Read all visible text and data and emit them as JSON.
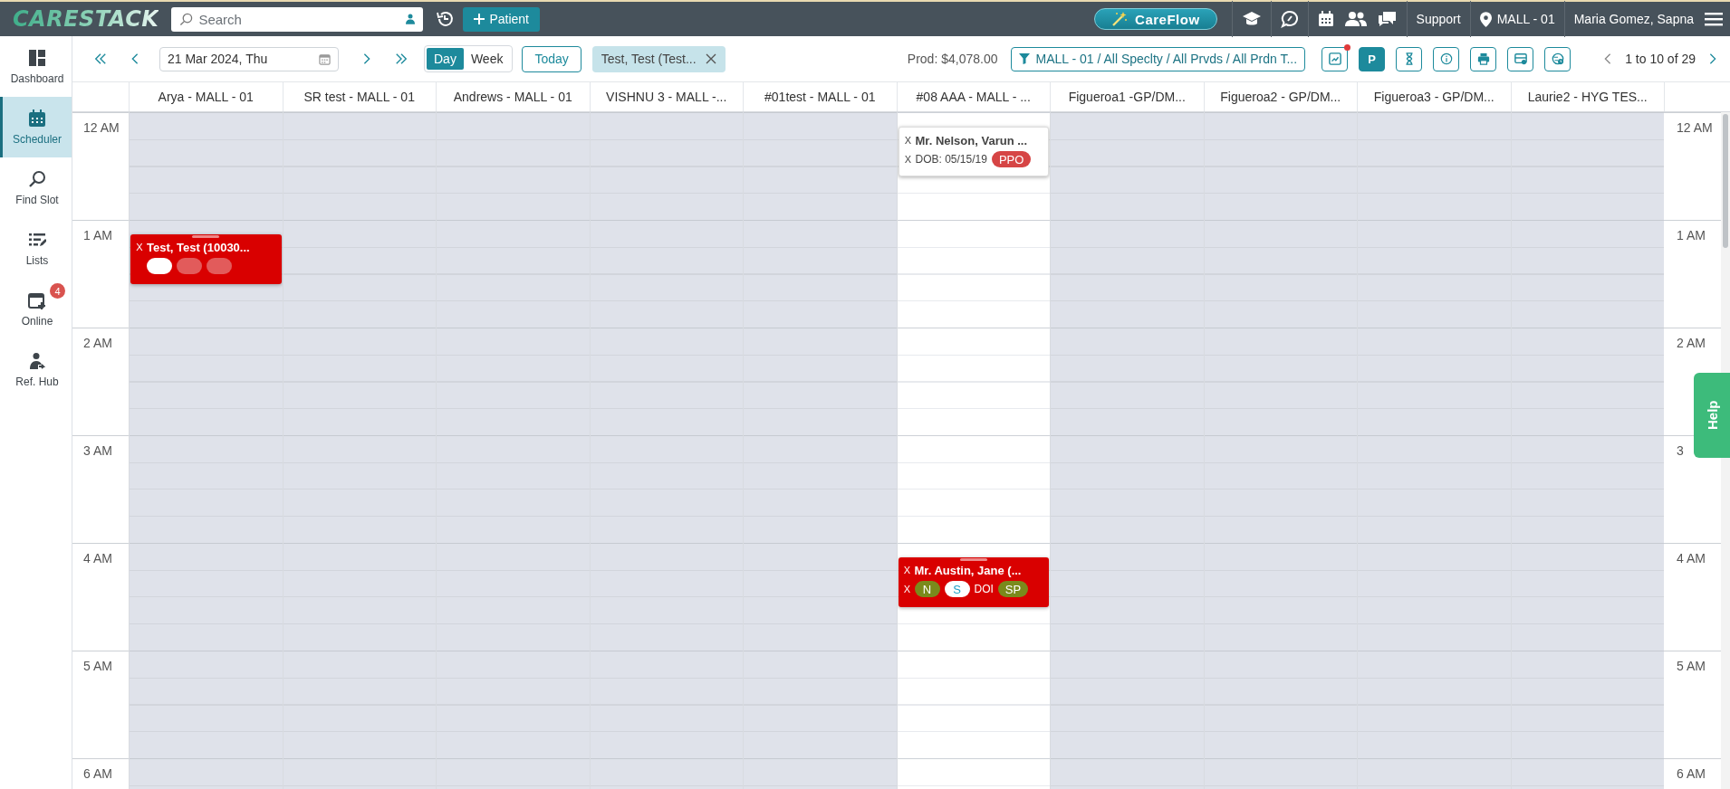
{
  "top_bar": {
    "logo": "CARESTACK",
    "search": {
      "placeholder": "Search"
    },
    "patient_button": "Patient",
    "careflow_button": "CareFlow",
    "support": "Support",
    "location": "MALL - 01",
    "user": "Maria Gomez, Sapna"
  },
  "sidebar": {
    "items": [
      {
        "kind": "dashboard",
        "label": "Dashboard",
        "selected": false
      },
      {
        "kind": "calendar",
        "label": "Scheduler",
        "selected": true
      },
      {
        "kind": "search",
        "label": "Find Slot",
        "selected": false
      },
      {
        "kind": "list",
        "label": "Lists",
        "selected": false
      },
      {
        "kind": "calendar-plus",
        "label": "Online",
        "selected": false,
        "badge": "4"
      },
      {
        "kind": "referral",
        "label": "Ref. Hub",
        "selected": false
      }
    ]
  },
  "toolbar": {
    "date": "21 Mar 2024, Thu",
    "view_tabs": [
      {
        "label": "Day",
        "selected": true
      },
      {
        "label": "Week",
        "selected": false
      }
    ],
    "today_button": "Today",
    "patient_chip": "Test, Test (Test...",
    "production": "Prod: $4,078.00",
    "filter": "MALL - 01 / All Speclty / All Prvds / All Prdn T...",
    "icon_buttons": [
      {
        "kind": "report",
        "alert": true,
        "on": false
      },
      {
        "kind": "letter",
        "label": "P",
        "alert": false,
        "on": true
      },
      {
        "kind": "hourglass",
        "alert": false,
        "on": false
      },
      {
        "kind": "info",
        "alert": false,
        "on": false
      },
      {
        "kind": "print",
        "alert": false,
        "on": false
      },
      {
        "kind": "layout",
        "alert": false,
        "on": false
      },
      {
        "kind": "clock",
        "alert": false,
        "on": false
      }
    ],
    "pagination": "1 to 10 of 29"
  },
  "scheduler": {
    "columns": [
      "Arya - MALL - 01",
      "SR test - MALL - 01",
      "Andrews - MALL - 01",
      "VISHNU 3 - MALL -...",
      "#01test - MALL - 01",
      "#08 AAA - MALL - ...",
      "Figueroa1 -GP/DM...",
      "Figueroa2 - GP/DM...",
      "Figueroa3 - GP/DM...",
      "Laurie2 - HYG TES..."
    ],
    "rows": [
      {
        "time": "12 AM",
        "right_time": "12 AM",
        "cells": [
          {
            "open": false
          },
          {
            "open": false
          },
          {
            "open": false
          },
          {
            "open": false
          },
          {
            "open": false
          },
          {
            "open": true,
            "appointment": {
              "color": "#ffffff",
              "close_marks": [
                "X",
                "X"
              ],
              "title": "Mr. Nelson, Varun ...",
              "details": [
                {
                  "kind": "text",
                  "label": "DOB: 05/15/19"
                },
                {
                  "kind": "chip",
                  "label": "PPO",
                  "color": "#d64545"
                }
              ]
            }
          },
          {
            "open": false
          },
          {
            "open": false
          },
          {
            "open": false
          },
          {
            "open": false
          }
        ]
      },
      {
        "time": "1 AM",
        "right_time": "1 AM",
        "cells": [
          {
            "open": false,
            "appointment": {
              "color": "#d90000",
              "close_marks": [
                "X"
              ],
              "title": "Test, Test (10030...",
              "details": [
                {
                  "kind": "chip",
                  "color": "#ffffff"
                },
                {
                  "kind": "chip",
                  "color": "#e25b5b"
                },
                {
                  "kind": "chip",
                  "color": "#e25b5b"
                }
              ]
            }
          },
          {
            "open": false
          },
          {
            "open": false
          },
          {
            "open": false
          },
          {
            "open": false
          },
          {
            "open": true
          },
          {
            "open": false
          },
          {
            "open": false
          },
          {
            "open": false
          },
          {
            "open": false
          }
        ]
      },
      {
        "time": "2 AM",
        "right_time": "2 AM",
        "cells": [
          {
            "open": false
          },
          {
            "open": false
          },
          {
            "open": false
          },
          {
            "open": false
          },
          {
            "open": false
          },
          {
            "open": true
          },
          {
            "open": false
          },
          {
            "open": false
          },
          {
            "open": false
          },
          {
            "open": false
          }
        ]
      },
      {
        "time": "3 AM",
        "right_time": "3",
        "cells": [
          {
            "open": false
          },
          {
            "open": false
          },
          {
            "open": false
          },
          {
            "open": false
          },
          {
            "open": false
          },
          {
            "open": true
          },
          {
            "open": false
          },
          {
            "open": false
          },
          {
            "open": false
          },
          {
            "open": false
          }
        ]
      },
      {
        "time": "4 AM",
        "right_time": "4 AM",
        "cells": [
          {
            "open": false
          },
          {
            "open": false
          },
          {
            "open": false
          },
          {
            "open": false
          },
          {
            "open": false
          },
          {
            "open": true,
            "appointment": {
              "color": "#d90000",
              "close_marks": [
                "X",
                "X"
              ],
              "title": "Mr. Austin, Jane (...",
              "details": [
                {
                  "kind": "chip",
                  "label": "N",
                  "color": "#7a8a1c"
                },
                {
                  "kind": "chip",
                  "label": "S",
                  "color": "#ffffff"
                },
                {
                  "kind": "text",
                  "label": "DOI"
                },
                {
                  "kind": "chip",
                  "label": "SP",
                  "color": "#7a8a1c"
                }
              ]
            }
          },
          {
            "open": false
          },
          {
            "open": false
          },
          {
            "open": false
          },
          {
            "open": false
          }
        ]
      },
      {
        "time": "5 AM",
        "right_time": "5 AM",
        "cells": [
          {
            "open": false
          },
          {
            "open": false
          },
          {
            "open": false
          },
          {
            "open": false
          },
          {
            "open": false
          },
          {
            "open": true
          },
          {
            "open": false
          },
          {
            "open": false
          },
          {
            "open": false
          },
          {
            "open": false
          }
        ]
      },
      {
        "time": "6 AM",
        "right_time": "6 AM",
        "cells": [
          {
            "open": false
          },
          {
            "open": false
          },
          {
            "open": false
          },
          {
            "open": false
          },
          {
            "open": false
          },
          {
            "open": true
          },
          {
            "open": false
          },
          {
            "open": false
          },
          {
            "open": false
          },
          {
            "open": false
          }
        ]
      }
    ]
  },
  "help_tab": "Help"
}
